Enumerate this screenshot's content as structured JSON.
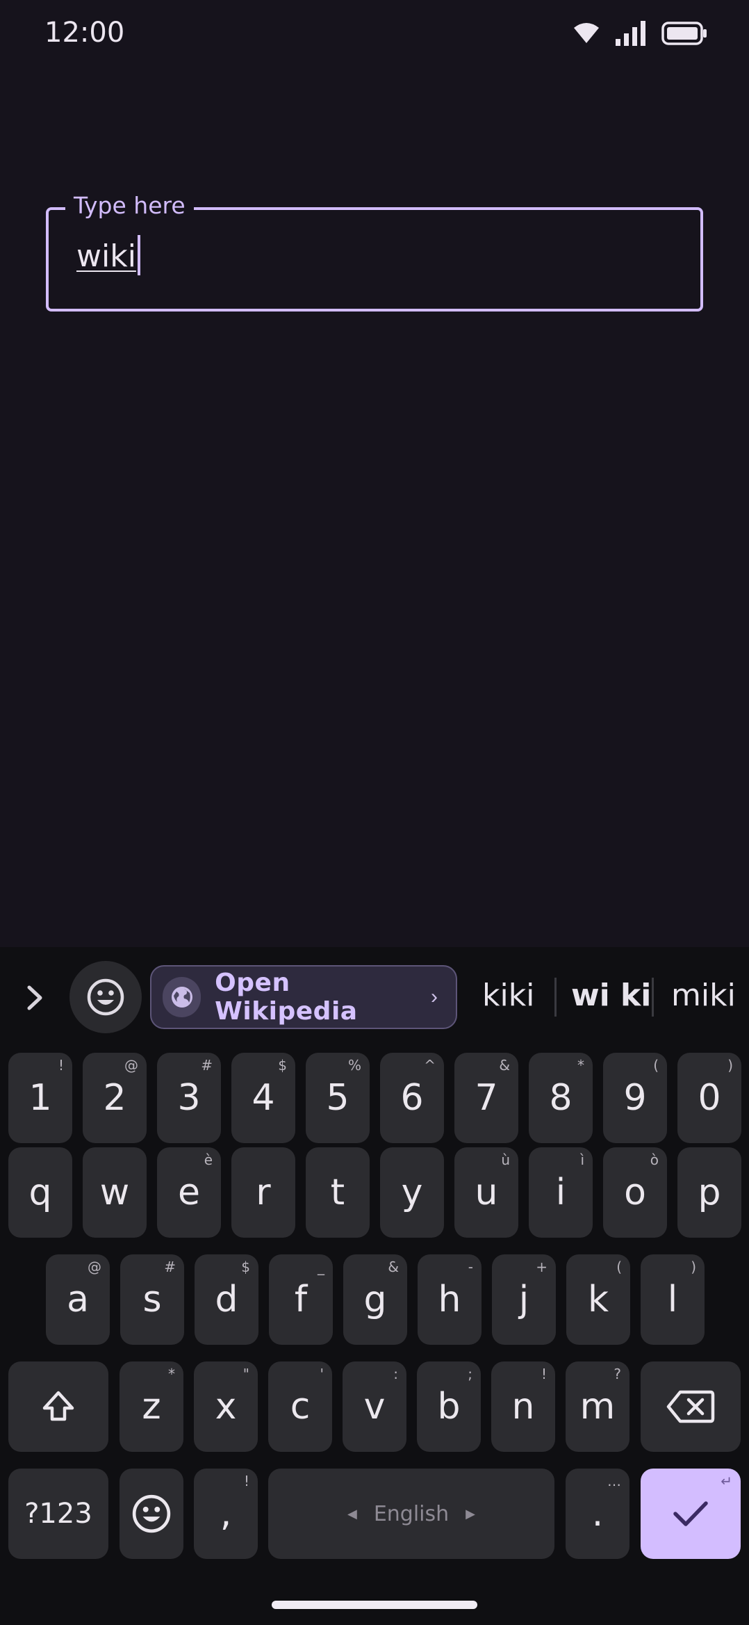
{
  "status_bar": {
    "time": "12:00"
  },
  "text_field": {
    "label": "Type here",
    "value": "wiki"
  },
  "suggestions": {
    "chip_label": "Open Wikipedia",
    "words": [
      "kiki",
      "wi ki",
      "miki"
    ]
  },
  "keyboard": {
    "row_numbers": [
      {
        "key": "1",
        "hint": "!"
      },
      {
        "key": "2",
        "hint": "@"
      },
      {
        "key": "3",
        "hint": "#"
      },
      {
        "key": "4",
        "hint": "$"
      },
      {
        "key": "5",
        "hint": "%"
      },
      {
        "key": "6",
        "hint": "^"
      },
      {
        "key": "7",
        "hint": "&"
      },
      {
        "key": "8",
        "hint": "*"
      },
      {
        "key": "9",
        "hint": "("
      },
      {
        "key": "0",
        "hint": ")"
      }
    ],
    "row_q": [
      {
        "key": "q",
        "hint": ""
      },
      {
        "key": "w",
        "hint": ""
      },
      {
        "key": "e",
        "hint": "è"
      },
      {
        "key": "r",
        "hint": ""
      },
      {
        "key": "t",
        "hint": ""
      },
      {
        "key": "y",
        "hint": ""
      },
      {
        "key": "u",
        "hint": "ù"
      },
      {
        "key": "i",
        "hint": "ì"
      },
      {
        "key": "o",
        "hint": "ò"
      },
      {
        "key": "p",
        "hint": ""
      }
    ],
    "row_a": [
      {
        "key": "a",
        "hint": "@"
      },
      {
        "key": "s",
        "hint": "#"
      },
      {
        "key": "d",
        "hint": "$"
      },
      {
        "key": "f",
        "hint": "_"
      },
      {
        "key": "g",
        "hint": "&"
      },
      {
        "key": "h",
        "hint": "-"
      },
      {
        "key": "j",
        "hint": "+"
      },
      {
        "key": "k",
        "hint": "("
      },
      {
        "key": "l",
        "hint": ")"
      }
    ],
    "row_z": [
      {
        "key": "z",
        "hint": "*"
      },
      {
        "key": "x",
        "hint": "\""
      },
      {
        "key": "c",
        "hint": "'"
      },
      {
        "key": "v",
        "hint": ":"
      },
      {
        "key": "b",
        "hint": ";"
      },
      {
        "key": "n",
        "hint": "!"
      },
      {
        "key": "m",
        "hint": "?"
      }
    ],
    "symbols_label": "?123",
    "comma": ",",
    "comma_hint": "!",
    "space_label": "English",
    "period": ".",
    "period_hint": "…",
    "enter_hint": "↵"
  },
  "colors": {
    "background": "#16131c",
    "accent": "#d2bcfc",
    "key": "#2c2c30",
    "keyboard_bg": "#0f0f12"
  },
  "icons": [
    "wifi-icon",
    "signal-icon",
    "battery-icon",
    "chevron-right-icon",
    "emoji-icon",
    "globe-icon",
    "shift-icon",
    "backspace-icon",
    "checkmark-icon"
  ]
}
